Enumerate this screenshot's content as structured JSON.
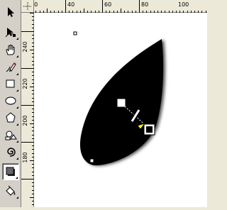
{
  "toolbox": {
    "tools": [
      {
        "name": "pick-tool",
        "icon": "arrow-pointer-icon"
      },
      {
        "name": "shape-tool",
        "icon": "shape-node-icon"
      },
      {
        "name": "pan-tool",
        "icon": "hand-icon"
      },
      {
        "name": "freehand-tool",
        "icon": "pencil-icon"
      },
      {
        "name": "rectangle-tool",
        "icon": "rectangle-icon"
      },
      {
        "name": "ellipse-tool",
        "icon": "ellipse-icon"
      },
      {
        "name": "polygon-tool",
        "icon": "polygon-icon"
      },
      {
        "name": "basic-shapes-tool",
        "icon": "basic-shapes-icon"
      },
      {
        "name": "spiral-tool",
        "icon": "spiral-icon"
      },
      {
        "name": "drop-shadow-tool",
        "icon": "drop-shadow-icon",
        "active": true
      },
      {
        "name": "fill-tool",
        "icon": "paint-bucket-icon"
      }
    ]
  },
  "horizontal_ruler": {
    "labels": [
      "20",
      "40",
      "60",
      "80",
      "100"
    ]
  },
  "vertical_ruler": {
    "labels": [
      "240",
      "220",
      "200",
      "180"
    ]
  },
  "colors": {
    "ui_background": "#ece9d8",
    "toolbox_background": "#d4d0c8",
    "canvas_background": "#ffffff",
    "shape_fill": "#000000",
    "shadow_handle_color": "#ffff00"
  }
}
